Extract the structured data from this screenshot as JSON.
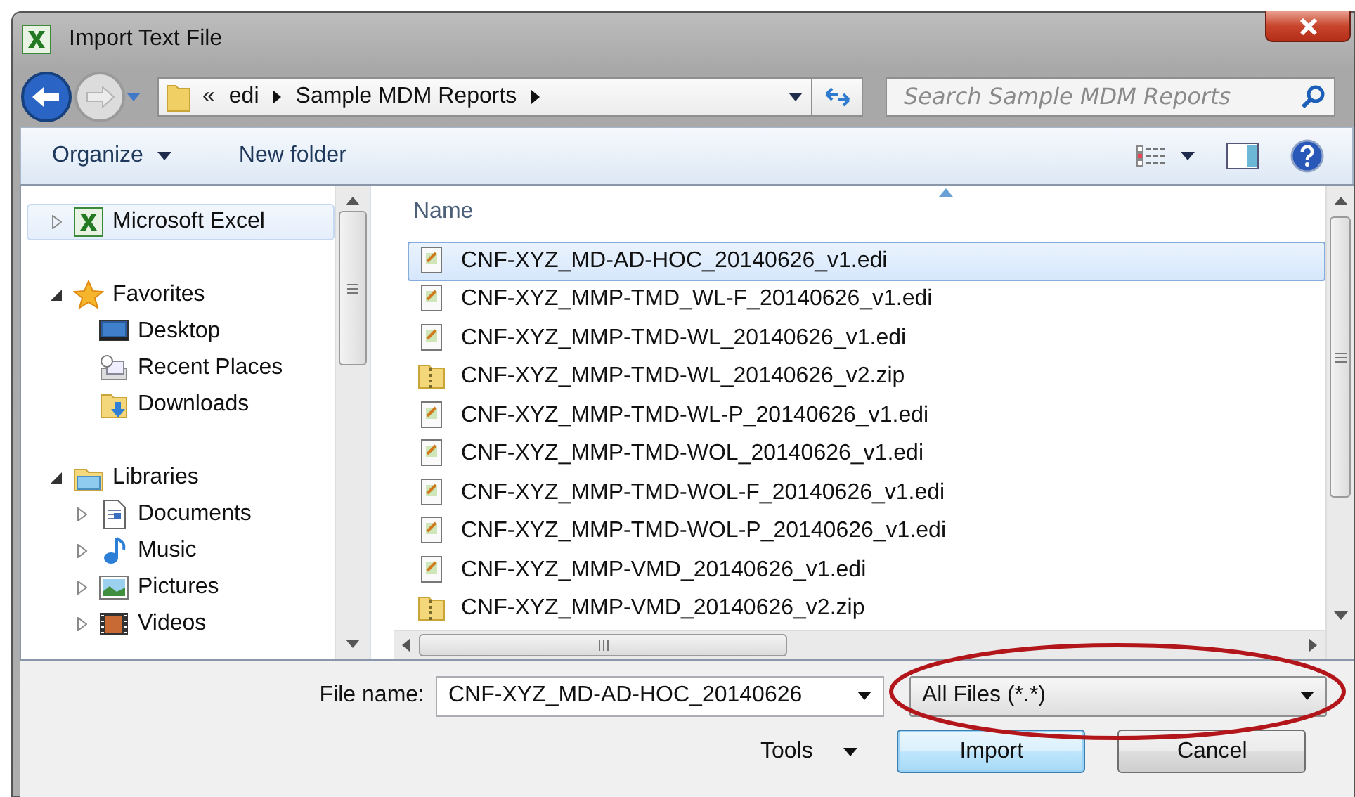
{
  "window": {
    "title": "Import Text File"
  },
  "address_bar": {
    "overflow_mark": "«",
    "breadcrumbs": [
      "edi",
      "Sample MDM Reports"
    ]
  },
  "search": {
    "placeholder": "Search Sample MDM Reports"
  },
  "toolbar": {
    "buttons": [
      {
        "label": "Organize",
        "kind": "menu"
      },
      {
        "label": "New folder",
        "kind": "plain"
      }
    ]
  },
  "navigation": {
    "items": [
      {
        "label": "Microsoft Excel",
        "kind": "excel",
        "expanded": false,
        "selected": true
      },
      {
        "label": "Favorites",
        "kind": "star",
        "expanded": true,
        "selected": false,
        "children": [
          {
            "label": "Desktop",
            "kind": "desktop",
            "selected": false
          },
          {
            "label": "Recent Places",
            "kind": "recent",
            "selected": false
          },
          {
            "label": "Downloads",
            "kind": "downloads",
            "selected": false
          }
        ]
      },
      {
        "label": "Libraries",
        "kind": "libraries",
        "expanded": true,
        "selected": false,
        "children": [
          {
            "label": "Documents",
            "kind": "documents",
            "expanded": false,
            "selected": false
          },
          {
            "label": "Music",
            "kind": "music",
            "expanded": false,
            "selected": false
          },
          {
            "label": "Pictures",
            "kind": "pictures",
            "expanded": false,
            "selected": false
          },
          {
            "label": "Videos",
            "kind": "videos",
            "expanded": false,
            "selected": false
          }
        ]
      }
    ]
  },
  "file_list": {
    "column": "Name",
    "files": [
      {
        "name": "CNF-XYZ_MD-AD-HOC_20140626_v1.edi",
        "kind": "edi",
        "selected": true
      },
      {
        "name": "CNF-XYZ_MMP-TMD_WL-F_20140626_v1.edi",
        "kind": "edi",
        "selected": false
      },
      {
        "name": "CNF-XYZ_MMP-TMD-WL_20140626_v1.edi",
        "kind": "edi",
        "selected": false
      },
      {
        "name": "CNF-XYZ_MMP-TMD-WL_20140626_v2.zip",
        "kind": "zip",
        "selected": false
      },
      {
        "name": "CNF-XYZ_MMP-TMD-WL-P_20140626_v1.edi",
        "kind": "edi",
        "selected": false
      },
      {
        "name": "CNF-XYZ_MMP-TMD-WOL_20140626_v1.edi",
        "kind": "edi",
        "selected": false
      },
      {
        "name": "CNF-XYZ_MMP-TMD-WOL-F_20140626_v1.edi",
        "kind": "edi",
        "selected": false
      },
      {
        "name": "CNF-XYZ_MMP-TMD-WOL-P_20140626_v1.edi",
        "kind": "edi",
        "selected": false
      },
      {
        "name": "CNF-XYZ_MMP-VMD_20140626_v1.edi",
        "kind": "edi",
        "selected": false
      },
      {
        "name": "CNF-XYZ_MMP-VMD_20140626_v2.zip",
        "kind": "zip",
        "selected": false
      }
    ]
  },
  "footer": {
    "file_name_label": "File name:",
    "file_name": "CNF-XYZ_MD-AD-HOC_20140626",
    "file_type": "All Files (*.*)",
    "tools": "Tools",
    "buttons": [
      {
        "label": "Import",
        "default": true
      },
      {
        "label": "Cancel",
        "default": false
      }
    ]
  },
  "annotation": {
    "kind": "ellipse"
  }
}
